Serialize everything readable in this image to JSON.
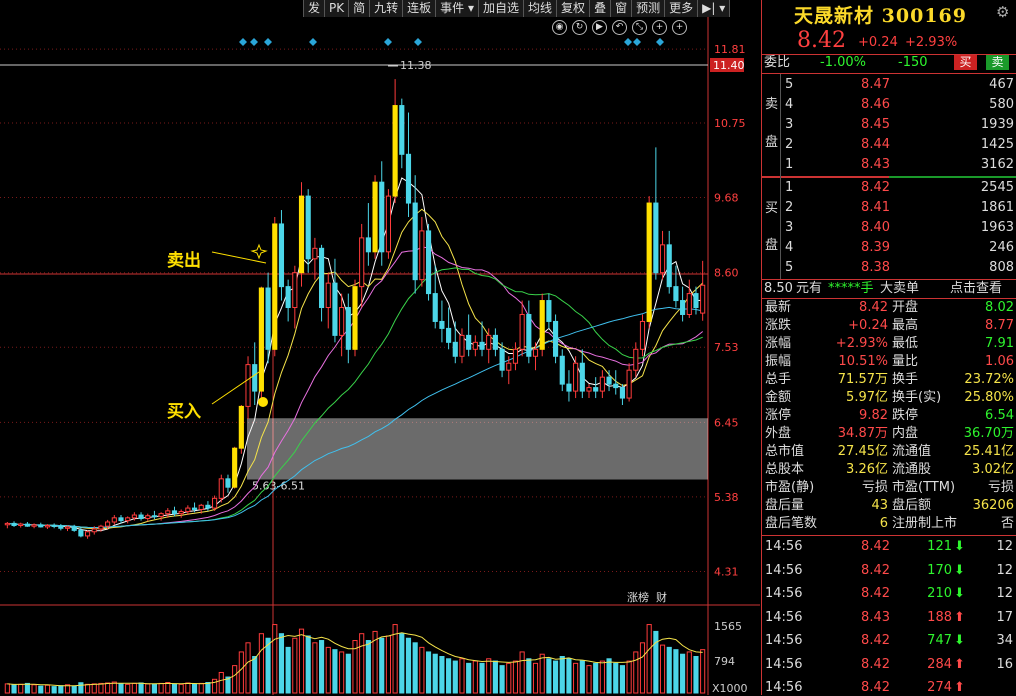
{
  "toolbar": {
    "items": [
      "发",
      "PK",
      "简",
      "九转",
      "连板",
      "事件 ▾",
      "加自选",
      "均线",
      "复权",
      "叠",
      "窗",
      "预测",
      "更多"
    ],
    "end": "▶| ▾"
  },
  "icons": [
    "eye-icon",
    "refresh-icon",
    "play-icon",
    "undo-icon",
    "shrink-icon",
    "plus-icon",
    "plus-icon"
  ],
  "stock": {
    "name": "天晟新材",
    "code": "300169",
    "price": "8.42",
    "change": "+0.24",
    "pct": "+2.93%"
  },
  "weibi": {
    "label": "委比",
    "pct": "-1.00%",
    "diff": "-150",
    "sell_btn": "买",
    "buy_btn": "卖"
  },
  "asks": [
    {
      "lvl": "5",
      "price": "8.47",
      "vol": "467"
    },
    {
      "lvl": "4",
      "price": "8.46",
      "vol": "580"
    },
    {
      "lvl": "3",
      "price": "8.45",
      "vol": "1939"
    },
    {
      "lvl": "2",
      "price": "8.44",
      "vol": "1425"
    },
    {
      "lvl": "1",
      "price": "8.43",
      "vol": "3162"
    }
  ],
  "ask_side": [
    "卖",
    "盘"
  ],
  "bids": [
    {
      "lvl": "1",
      "price": "8.42",
      "vol": "2545"
    },
    {
      "lvl": "2",
      "price": "8.41",
      "vol": "1861"
    },
    {
      "lvl": "3",
      "price": "8.40",
      "vol": "1963"
    },
    {
      "lvl": "4",
      "price": "8.39",
      "vol": "246"
    },
    {
      "lvl": "5",
      "price": "8.38",
      "vol": "808"
    }
  ],
  "bid_side": [
    "买",
    "盘"
  ],
  "bigorder": {
    "p1": "8.50",
    "p2": "元有",
    "p3": "*****手",
    "p4": "大卖单",
    "link": "点击查看"
  },
  "stats": [
    {
      "l": "最新",
      "v": "8.42",
      "vc": "r",
      "l2": "开盘",
      "v2": "8.02",
      "v2c": "g"
    },
    {
      "l": "涨跌",
      "v": "+0.24",
      "vc": "r",
      "l2": "最高",
      "v2": "8.77",
      "v2c": "r"
    },
    {
      "l": "涨幅",
      "v": "+2.93%",
      "vc": "r",
      "l2": "最低",
      "v2": "7.91",
      "v2c": "g"
    },
    {
      "l": "振幅",
      "v": "10.51%",
      "vc": "r",
      "l2": "量比",
      "v2": "1.06",
      "v2c": "r"
    },
    {
      "l": "总手",
      "v": "71.57万",
      "vc": "y",
      "l2": "换手",
      "v2": "23.72%",
      "v2c": "y"
    },
    {
      "l": "金额",
      "v": "5.97亿",
      "vc": "y",
      "l2": "换手(实)",
      "v2": "25.80%",
      "v2c": "y"
    },
    {
      "l": "涨停",
      "v": "9.82",
      "vc": "r",
      "l2": "跌停",
      "v2": "6.54",
      "v2c": "g"
    },
    {
      "l": "外盘",
      "v": "34.87万",
      "vc": "r",
      "l2": "内盘",
      "v2": "36.70万",
      "v2c": "g"
    },
    {
      "l": "总市值",
      "v": "27.45亿",
      "vc": "y",
      "l2": "流通值",
      "v2": "25.41亿",
      "v2c": "y"
    },
    {
      "l": "总股本",
      "v": "3.26亿",
      "vc": "y",
      "l2": "流通股",
      "v2": "3.02亿",
      "v2c": "y"
    },
    {
      "l": "市盈(静)",
      "v": "亏损",
      "vc": "w",
      "l2": "市盈(TTM)",
      "v2": "亏损",
      "v2c": "w"
    },
    {
      "l": "盘后量",
      "v": "43",
      "vc": "y",
      "l2": "盘后额",
      "v2": "36206",
      "v2c": "y"
    },
    {
      "l": "盘后笔数",
      "v": "6",
      "vc": "y",
      "l2": "注册制上市",
      "v2": "否",
      "v2c": "w"
    }
  ],
  "ticks": [
    {
      "t": "14:56",
      "p": "8.42",
      "v": "121",
      "d": "down",
      "n": "12"
    },
    {
      "t": "14:56",
      "p": "8.42",
      "v": "170",
      "d": "down",
      "n": "12"
    },
    {
      "t": "14:56",
      "p": "8.42",
      "v": "210",
      "d": "down",
      "n": "12"
    },
    {
      "t": "14:56",
      "p": "8.43",
      "v": "188",
      "d": "up",
      "n": "17"
    },
    {
      "t": "14:56",
      "p": "8.42",
      "v": "747",
      "d": "down",
      "n": "34"
    },
    {
      "t": "14:56",
      "p": "8.42",
      "v": "284",
      "d": "up",
      "n": "16"
    },
    {
      "t": "14:56",
      "p": "8.42",
      "v": "274",
      "d": "up",
      "n": ""
    }
  ],
  "chart_data": {
    "type": "candlestick",
    "y_ticks": [
      "11.81",
      "10.75",
      "9.68",
      "8.60",
      "7.53",
      "6.45",
      "5.38",
      "4.31"
    ],
    "ylim": [
      3.9,
      12.2
    ],
    "current_price_tag": "11.40",
    "high_label": "11.38",
    "zone_label": "5.63-6.51",
    "zone": [
      5.63,
      6.51
    ],
    "annotations": [
      "卖出",
      "买入"
    ],
    "bottom_labels": [
      "涨榜",
      "财"
    ],
    "vol_ticks": [
      "1565",
      "794"
    ],
    "vol_unit": "X1000",
    "colors": {
      "up": "#ff3c3c",
      "down": "#4cd6e8",
      "ma5": "#ffffff",
      "ma10": "#f5e34a",
      "ma20": "#e870e0",
      "ma30": "#39d24a",
      "ma60": "#40c0ee"
    },
    "candles": [
      [
        4.98,
        5.02,
        4.93,
        5.0
      ],
      [
        5.0,
        5.03,
        4.95,
        4.97
      ],
      [
        4.97,
        5.01,
        4.94,
        4.99
      ],
      [
        4.99,
        5.02,
        4.95,
        4.96
      ],
      [
        4.96,
        5.0,
        4.93,
        4.98
      ],
      [
        4.98,
        5.01,
        4.94,
        4.95
      ],
      [
        4.95,
        4.99,
        4.92,
        4.97
      ],
      [
        4.97,
        5.0,
        4.93,
        4.96
      ],
      [
        4.96,
        4.99,
        4.9,
        4.93
      ],
      [
        4.93,
        4.97,
        4.89,
        4.95
      ],
      [
        4.95,
        4.98,
        4.88,
        4.9
      ],
      [
        4.9,
        4.95,
        4.8,
        4.82
      ],
      [
        4.82,
        4.9,
        4.78,
        4.88
      ],
      [
        4.88,
        4.96,
        4.84,
        4.92
      ],
      [
        4.92,
        4.98,
        4.88,
        4.96
      ],
      [
        4.96,
        5.05,
        4.92,
        5.02
      ],
      [
        5.02,
        5.12,
        4.98,
        5.08
      ],
      [
        5.08,
        5.12,
        5.0,
        5.04
      ],
      [
        5.04,
        5.1,
        5.0,
        5.08
      ],
      [
        5.08,
        5.16,
        5.04,
        5.12
      ],
      [
        5.12,
        5.16,
        5.04,
        5.07
      ],
      [
        5.07,
        5.14,
        5.03,
        5.11
      ],
      [
        5.11,
        5.18,
        5.06,
        5.1
      ],
      [
        5.1,
        5.16,
        5.04,
        5.14
      ],
      [
        5.14,
        5.22,
        5.08,
        5.18
      ],
      [
        5.18,
        5.24,
        5.1,
        5.14
      ],
      [
        5.14,
        5.2,
        5.08,
        5.17
      ],
      [
        5.17,
        5.26,
        5.12,
        5.22
      ],
      [
        5.22,
        5.3,
        5.16,
        5.2
      ],
      [
        5.2,
        5.28,
        5.14,
        5.26
      ],
      [
        5.26,
        5.32,
        5.18,
        5.22
      ],
      [
        5.22,
        5.4,
        5.18,
        5.36
      ],
      [
        5.36,
        5.7,
        5.3,
        5.64
      ],
      [
        5.64,
        5.7,
        5.44,
        5.52
      ],
      [
        5.52,
        6.1,
        5.5,
        6.08
      ],
      [
        6.08,
        6.7,
        6.0,
        6.68
      ],
      [
        6.68,
        7.4,
        6.5,
        7.28
      ],
      [
        7.28,
        7.6,
        6.7,
        6.9
      ],
      [
        6.9,
        8.4,
        6.8,
        8.38
      ],
      [
        8.38,
        8.6,
        7.3,
        7.5
      ],
      [
        7.5,
        9.4,
        7.4,
        9.3
      ],
      [
        9.3,
        9.5,
        8.2,
        8.4
      ],
      [
        8.4,
        8.5,
        7.9,
        8.1
      ],
      [
        8.1,
        8.7,
        7.8,
        8.6
      ],
      [
        8.6,
        9.9,
        8.4,
        9.7
      ],
      [
        9.7,
        9.8,
        8.6,
        8.8
      ],
      [
        8.8,
        9.1,
        8.5,
        8.95
      ],
      [
        8.95,
        9.0,
        7.9,
        8.1
      ],
      [
        8.1,
        8.6,
        7.8,
        8.45
      ],
      [
        8.45,
        8.8,
        7.6,
        7.7
      ],
      [
        7.7,
        8.3,
        7.4,
        8.1
      ],
      [
        8.1,
        8.3,
        7.3,
        7.5
      ],
      [
        7.5,
        8.5,
        7.4,
        8.4
      ],
      [
        8.4,
        9.3,
        8.1,
        9.1
      ],
      [
        9.1,
        9.6,
        8.7,
        8.9
      ],
      [
        8.9,
        10.0,
        8.8,
        9.9
      ],
      [
        9.9,
        10.2,
        8.7,
        8.9
      ],
      [
        8.9,
        9.8,
        8.8,
        9.7
      ],
      [
        9.7,
        11.38,
        9.6,
        11.0
      ],
      [
        11.0,
        11.1,
        10.1,
        10.3
      ],
      [
        10.3,
        10.9,
        9.4,
        9.6
      ],
      [
        9.6,
        10.0,
        8.3,
        8.5
      ],
      [
        8.5,
        9.4,
        8.4,
        9.2
      ],
      [
        9.2,
        9.3,
        8.2,
        8.3
      ],
      [
        8.3,
        8.7,
        7.8,
        7.9
      ],
      [
        7.9,
        8.2,
        7.6,
        7.8
      ],
      [
        7.8,
        8.1,
        7.5,
        7.6
      ],
      [
        7.6,
        7.9,
        7.3,
        7.4
      ],
      [
        7.4,
        7.8,
        7.3,
        7.7
      ],
      [
        7.7,
        8.0,
        7.4,
        7.5
      ],
      [
        7.5,
        7.7,
        7.4,
        7.6
      ],
      [
        7.6,
        7.9,
        7.4,
        7.5
      ],
      [
        7.5,
        7.8,
        7.3,
        7.7
      ],
      [
        7.7,
        7.8,
        7.4,
        7.5
      ],
      [
        7.5,
        7.6,
        7.1,
        7.2
      ],
      [
        7.2,
        7.4,
        7.0,
        7.3
      ],
      [
        7.3,
        7.6,
        7.2,
        7.5
      ],
      [
        7.5,
        8.2,
        7.4,
        8.0
      ],
      [
        8.0,
        8.2,
        7.3,
        7.4
      ],
      [
        7.4,
        7.6,
        7.2,
        7.5
      ],
      [
        7.5,
        8.3,
        7.4,
        8.2
      ],
      [
        8.2,
        8.3,
        7.8,
        7.9
      ],
      [
        7.9,
        8.0,
        7.3,
        7.4
      ],
      [
        7.4,
        7.5,
        6.9,
        7.0
      ],
      [
        7.0,
        7.2,
        6.75,
        6.9
      ],
      [
        6.9,
        7.4,
        6.8,
        7.3
      ],
      [
        7.3,
        7.5,
        6.8,
        6.9
      ],
      [
        6.9,
        7.0,
        6.8,
        6.95
      ],
      [
        6.95,
        7.1,
        6.8,
        6.9
      ],
      [
        6.9,
        7.2,
        6.8,
        7.1
      ],
      [
        7.1,
        7.2,
        6.9,
        7.0
      ],
      [
        7.0,
        7.2,
        6.85,
        6.95
      ],
      [
        6.95,
        7.0,
        6.7,
        6.8
      ],
      [
        6.8,
        7.3,
        6.75,
        7.2
      ],
      [
        7.2,
        7.6,
        7.1,
        7.5
      ],
      [
        7.5,
        8.0,
        7.4,
        7.9
      ],
      [
        7.9,
        9.7,
        7.8,
        9.6
      ],
      [
        9.6,
        10.4,
        8.5,
        8.6
      ],
      [
        8.6,
        9.2,
        8.5,
        9.0
      ],
      [
        9.0,
        9.2,
        8.3,
        8.4
      ],
      [
        8.4,
        8.7,
        8.1,
        8.2
      ],
      [
        8.2,
        8.4,
        7.9,
        8.0
      ],
      [
        8.0,
        8.5,
        7.95,
        8.3
      ],
      [
        8.3,
        8.4,
        8.0,
        8.1
      ],
      [
        8.02,
        8.77,
        7.91,
        8.42
      ]
    ],
    "volumes": [
      40,
      35,
      38,
      42,
      36,
      30,
      34,
      28,
      32,
      36,
      30,
      45,
      38,
      40,
      42,
      44,
      48,
      40,
      38,
      42,
      44,
      40,
      38,
      42,
      46,
      40,
      38,
      44,
      40,
      42,
      46,
      60,
      90,
      70,
      120,
      180,
      220,
      160,
      260,
      240,
      300,
      260,
      200,
      240,
      280,
      250,
      220,
      230,
      200,
      190,
      180,
      170,
      230,
      260,
      230,
      270,
      240,
      250,
      300,
      260,
      240,
      220,
      200,
      180,
      170,
      160,
      150,
      140,
      150,
      130,
      140,
      130,
      150,
      140,
      120,
      130,
      140,
      180,
      150,
      130,
      170,
      150,
      140,
      160,
      150,
      130,
      140,
      120,
      130,
      140,
      150,
      130,
      120,
      140,
      180,
      220,
      300,
      270,
      210,
      200,
      190,
      170,
      180,
      160,
      190
    ]
  }
}
